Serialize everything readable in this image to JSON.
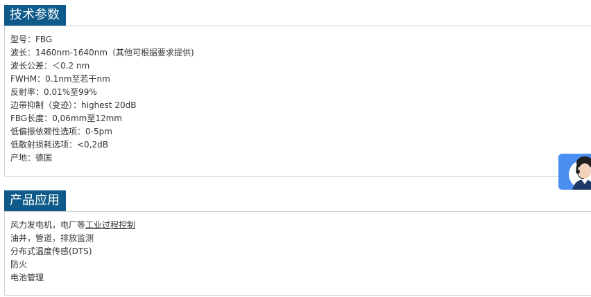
{
  "specs": {
    "title": "技术参数",
    "rows": [
      "型号：FBG",
      "波长：1460nm-1640nm（其他可根据要求提供)",
      "波长公差：＜0.2 nm",
      "FWHM：0.1nm至若干nm",
      "反射率：0.01%至99%",
      "边带抑制（变迹）：highest 20dB",
      "FBG长度：0,06mm至12mm",
      "低偏振依赖性选项：0-5pm",
      "低散射损耗选项：<0,2dB",
      "产地：德国"
    ]
  },
  "applications": {
    "title": "产品应用",
    "row1_prefix": "风力发电机，电厂等",
    "row1_link": "工业过程控制",
    "rows": [
      "油井，管道，排放监测",
      "分布式温度传感(DTS)",
      "防火",
      "电池管理"
    ]
  },
  "colors": {
    "header_bg": "#0e5a8a",
    "service_widget_bg": "#4a8ff0"
  },
  "icons": {
    "service_widget": "customer-service-agent-icon"
  }
}
